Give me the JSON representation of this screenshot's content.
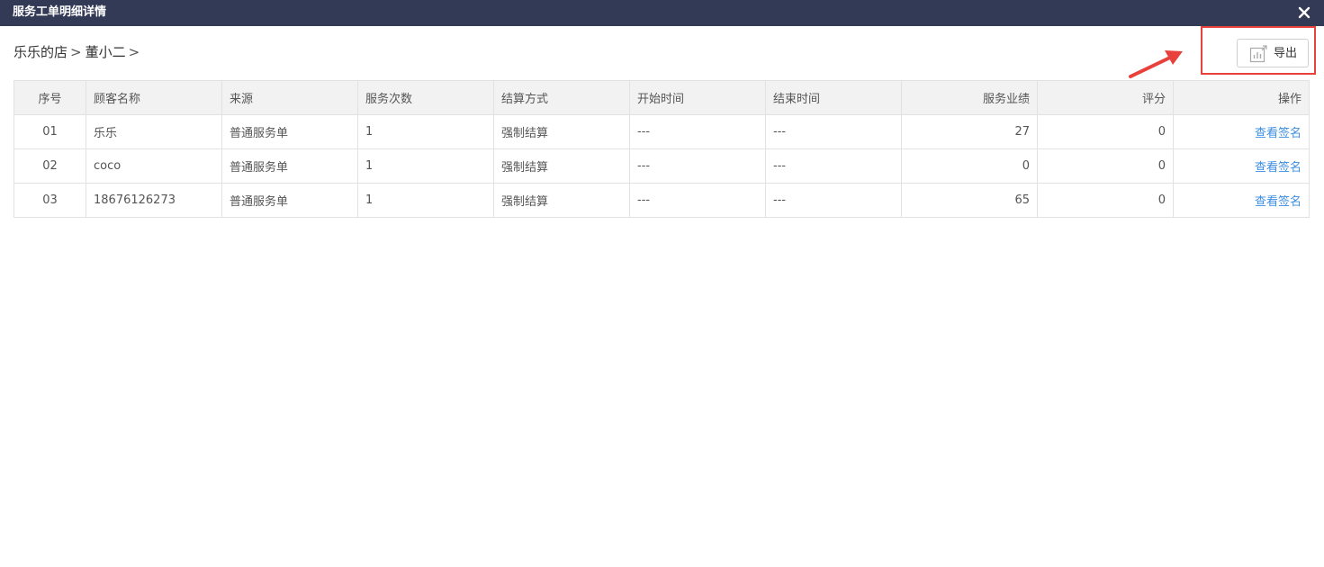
{
  "window": {
    "title": "服务工单明细详情"
  },
  "breadcrumb": {
    "items": [
      "乐乐的店",
      "董小二"
    ],
    "separator": ">"
  },
  "toolbar": {
    "export_label": "导出"
  },
  "colors": {
    "titlebar": "#333a56",
    "highlight": "#e8403a",
    "link": "#3d8ee0",
    "header_bg": "#f2f2f2"
  },
  "table": {
    "columns": [
      "序号",
      "顾客名称",
      "来源",
      "服务次数",
      "结算方式",
      "开始时间",
      "结束时间",
      "服务业绩",
      "评分",
      "操作"
    ],
    "rows": [
      {
        "index": "01",
        "customer": "乐乐",
        "source": "普通服务单",
        "count": "1",
        "settlement": "强制结算",
        "start": "---",
        "end": "---",
        "performance": "27",
        "score": "0",
        "action": "查看签名"
      },
      {
        "index": "02",
        "customer": "coco",
        "source": "普通服务单",
        "count": "1",
        "settlement": "强制结算",
        "start": "---",
        "end": "---",
        "performance": "0",
        "score": "0",
        "action": "查看签名"
      },
      {
        "index": "03",
        "customer": "18676126273",
        "source": "普通服务单",
        "count": "1",
        "settlement": "强制结算",
        "start": "---",
        "end": "---",
        "performance": "65",
        "score": "0",
        "action": "查看签名"
      }
    ]
  }
}
